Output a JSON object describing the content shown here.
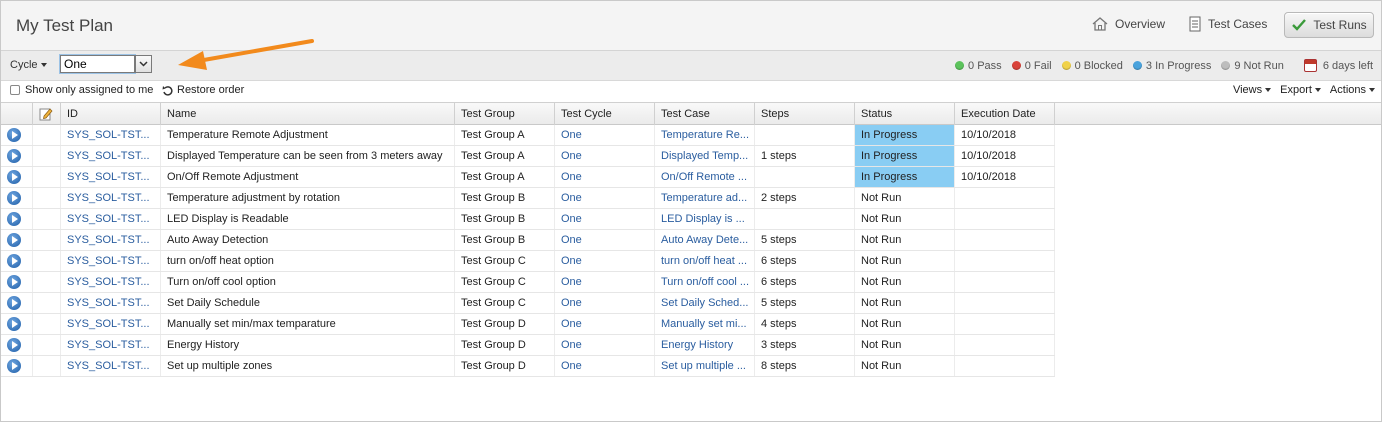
{
  "header": {
    "title": "My Test Plan",
    "nav": [
      {
        "label": "Overview",
        "icon": "home-icon"
      },
      {
        "label": "Test Cases",
        "icon": "document-icon"
      },
      {
        "label": "Test Runs",
        "icon": "checkmark-icon"
      }
    ]
  },
  "toolbar": {
    "cycle_label": "Cycle",
    "cycle_value": "One",
    "stats": [
      {
        "label": "0 Pass",
        "color": "#5cc35c"
      },
      {
        "label": "0 Fail",
        "color": "#d9433a"
      },
      {
        "label": "0 Blocked",
        "color": "#f0d24a"
      },
      {
        "label": "3 In Progress",
        "color": "#4aa3dd"
      },
      {
        "label": "9 Not Run",
        "color": "#bdbdbd"
      }
    ],
    "days_left": "6 days left"
  },
  "subbar": {
    "show_assigned": "Show only assigned to me",
    "restore_order": "Restore order",
    "menus": [
      "Views",
      "Export",
      "Actions"
    ]
  },
  "table": {
    "columns": [
      "ID",
      "Name",
      "Test Group",
      "Test Cycle",
      "Test Case",
      "Steps",
      "Status",
      "Execution Date"
    ],
    "rows": [
      {
        "id": "SYS_SOL-TST...",
        "name": "Temperature Remote Adjustment",
        "group": "Test Group A",
        "cycle": "One",
        "case": "Temperature Re...",
        "steps": "",
        "status": "In Progress",
        "date": "10/10/2018"
      },
      {
        "id": "SYS_SOL-TST...",
        "name": "Displayed Temperature can be seen from 3 meters away",
        "group": "Test Group A",
        "cycle": "One",
        "case": "Displayed Temp...",
        "steps": "1 steps",
        "status": "In Progress",
        "date": "10/10/2018"
      },
      {
        "id": "SYS_SOL-TST...",
        "name": "On/Off Remote Adjustment",
        "group": "Test Group A",
        "cycle": "One",
        "case": "On/Off Remote ...",
        "steps": "",
        "status": "In Progress",
        "date": "10/10/2018"
      },
      {
        "id": "SYS_SOL-TST...",
        "name": "Temperature adjustment by rotation",
        "group": "Test Group B",
        "cycle": "One",
        "case": "Temperature ad...",
        "steps": "2 steps",
        "status": "Not Run",
        "date": ""
      },
      {
        "id": "SYS_SOL-TST...",
        "name": "LED Display is Readable",
        "group": "Test Group B",
        "cycle": "One",
        "case": "LED Display is ...",
        "steps": "",
        "status": "Not Run",
        "date": ""
      },
      {
        "id": "SYS_SOL-TST...",
        "name": "Auto Away Detection",
        "group": "Test Group B",
        "cycle": "One",
        "case": "Auto Away Dete...",
        "steps": "5 steps",
        "status": "Not Run",
        "date": ""
      },
      {
        "id": "SYS_SOL-TST...",
        "name": "turn on/off heat option",
        "group": "Test Group C",
        "cycle": "One",
        "case": "turn on/off heat ...",
        "steps": "6 steps",
        "status": "Not Run",
        "date": ""
      },
      {
        "id": "SYS_SOL-TST...",
        "name": "Turn on/off cool option",
        "group": "Test Group C",
        "cycle": "One",
        "case": "Turn on/off cool ...",
        "steps": "6 steps",
        "status": "Not Run",
        "date": ""
      },
      {
        "id": "SYS_SOL-TST...",
        "name": "Set Daily Schedule",
        "group": "Test Group C",
        "cycle": "One",
        "case": "Set Daily Sched...",
        "steps": "5 steps",
        "status": "Not Run",
        "date": ""
      },
      {
        "id": "SYS_SOL-TST...",
        "name": "Manually set min/max temparature",
        "group": "Test Group D",
        "cycle": "One",
        "case": "Manually set mi...",
        "steps": "4 steps",
        "status": "Not Run",
        "date": ""
      },
      {
        "id": "SYS_SOL-TST...",
        "name": "Energy History",
        "group": "Test Group D",
        "cycle": "One",
        "case": "Energy History",
        "steps": "3 steps",
        "status": "Not Run",
        "date": ""
      },
      {
        "id": "SYS_SOL-TST...",
        "name": "Set up multiple zones",
        "group": "Test Group D",
        "cycle": "One",
        "case": "Set up multiple ...",
        "steps": "8 steps",
        "status": "Not Run",
        "date": ""
      }
    ]
  },
  "colors": {
    "link": "#2a5d9f",
    "in_progress_bg": "#89cdf3",
    "arrow": "#f28a1c"
  }
}
